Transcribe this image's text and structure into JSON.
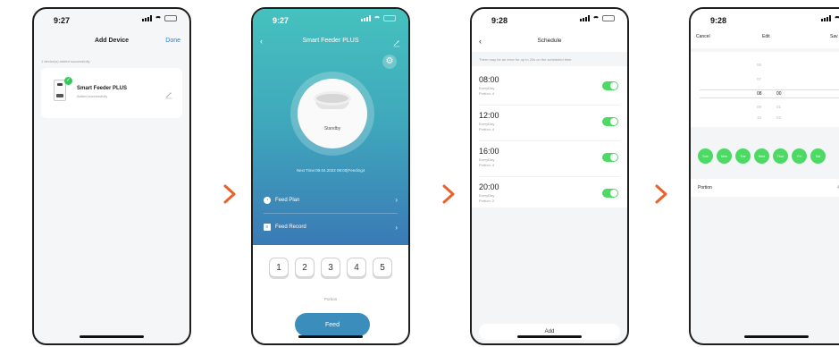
{
  "status": {
    "screen1_time": "9:27",
    "screen2_time": "9:27",
    "screen3_time": "9:28",
    "screen4_time": "9:28"
  },
  "add_device": {
    "title": "Add Device",
    "done": "Done",
    "added_count": "1 device(s) added successfully",
    "device_name": "Smart Feeder PLUS",
    "device_status": "Added successfully"
  },
  "feeder": {
    "title": "Smart Feeder PLUS",
    "state": "Standby",
    "next_time": "Next Time:09.04.2022 08:00|Feeding4",
    "menu": [
      {
        "label": "Feed Plan"
      },
      {
        "label": "Feed Record"
      }
    ],
    "portions": [
      "1",
      "2",
      "3",
      "4",
      "5"
    ],
    "portion_label": "Portion",
    "feed_button": "Feed"
  },
  "schedule": {
    "title": "Schedule",
    "note": "There may be an error for up to 20s on the scheduled time.",
    "items": [
      {
        "time": "08:00",
        "repeat": "EveryDay",
        "portion": "Portion: 4",
        "enabled": true
      },
      {
        "time": "12:00",
        "repeat": "EveryDay",
        "portion": "Portion: 4",
        "enabled": true
      },
      {
        "time": "16:00",
        "repeat": "EveryDay",
        "portion": "Portion: 4",
        "enabled": true
      },
      {
        "time": "20:00",
        "repeat": "EveryDay",
        "portion": "Portion: 2",
        "enabled": true
      }
    ],
    "add_button": "Add"
  },
  "edit": {
    "cancel": "Cancel",
    "title": "Edit",
    "save": "Sav",
    "hours": [
      "05",
      "06",
      "07",
      "08",
      "09",
      "10",
      "11"
    ],
    "minutes": [
      "00",
      "01",
      "02"
    ],
    "selected_hour": "08",
    "selected_minute": "00",
    "days": [
      "Sun",
      "Mon",
      "Tue",
      "Wed",
      "Thur",
      "Fri",
      "Sat"
    ],
    "portion_label": "Portion",
    "portion_value": "4"
  },
  "colors": {
    "accent_orange": "#e8622c",
    "toggle_green": "#4cd964",
    "feed_blue": "#3b8dbb",
    "link_blue": "#2b7de9"
  }
}
